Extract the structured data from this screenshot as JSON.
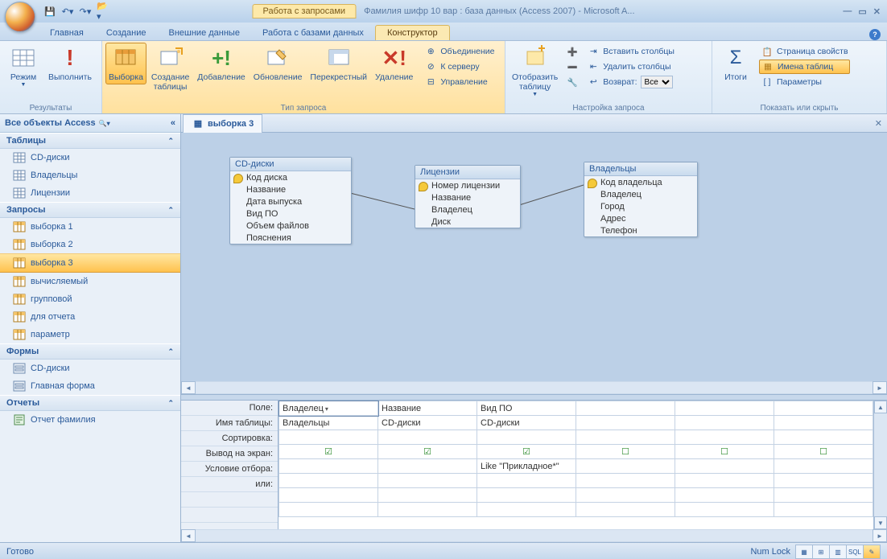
{
  "title": {
    "context_tab": "Работа с запросами",
    "document": "Фамилия шифр 10 вар : база данных (Access 2007) - Microsoft A..."
  },
  "tabs": {
    "home": "Главная",
    "create": "Создание",
    "external": "Внешние данные",
    "dbtools": "Работа с базами данных",
    "design": "Конструктор"
  },
  "ribbon": {
    "results": {
      "label": "Результаты",
      "view": "Режим",
      "run": "Выполнить"
    },
    "qtype": {
      "label": "Тип запроса",
      "select": "Выборка",
      "maketable": "Создание\nтаблицы",
      "append": "Добавление",
      "update": "Обновление",
      "crosstab": "Перекрестный",
      "delete": "Удаление",
      "union": "Объединение",
      "passthrough": "К серверу",
      "datadef": "Управление"
    },
    "setup": {
      "label": "Настройка запроса",
      "showtable": "Отобразить\nтаблицу",
      "insertcols": "Вставить столбцы",
      "deletecols": "Удалить столбцы",
      "return": "Возврат:",
      "return_val": "Все"
    },
    "showhide": {
      "label": "Показать или скрыть",
      "totals": "Итоги",
      "propsheet": "Страница свойств",
      "tablenames": "Имена таблиц",
      "params": "Параметры"
    }
  },
  "nav": {
    "title": "Все объекты Access",
    "cat_tables": "Таблицы",
    "tables": [
      "CD-диски",
      "Владельцы",
      "Лицензии"
    ],
    "cat_queries": "Запросы",
    "queries": [
      "выборка 1",
      "выборка 2",
      "выборка 3",
      "вычисляемый",
      "групповой",
      "для отчета",
      "параметр"
    ],
    "query_selected": "выборка 3",
    "cat_forms": "Формы",
    "forms": [
      "CD-диски",
      "Главная форма"
    ],
    "cat_reports": "Отчеты",
    "reports": [
      "Отчет фамилия"
    ]
  },
  "doc": {
    "tab": "выборка 3"
  },
  "tables": {
    "t1": {
      "title": "CD-диски",
      "fields": [
        "Код диска",
        "Название",
        "Дата выпуска",
        "Вид ПО",
        "Объем файлов",
        "Пояснения"
      ],
      "key": 0
    },
    "t2": {
      "title": "Лицензии",
      "fields": [
        "Номер лицензии",
        "Название",
        "Владелец",
        "Диск"
      ],
      "key": 0
    },
    "t3": {
      "title": "Владельцы",
      "fields": [
        "Код владельца",
        "Владелец",
        "Город",
        "Адрес",
        "Телефон"
      ],
      "key": 0
    }
  },
  "grid": {
    "labels": {
      "field": "Поле:",
      "table": "Имя таблицы:",
      "sort": "Сортировка:",
      "show": "Вывод на экран:",
      "criteria": "Условие отбора:",
      "or": "или:"
    },
    "cols": [
      {
        "field": "Владелец",
        "table": "Владельцы",
        "show": true,
        "criteria": ""
      },
      {
        "field": "Название",
        "table": "CD-диски",
        "show": true,
        "criteria": ""
      },
      {
        "field": "Вид ПО",
        "table": "CD-диски",
        "show": true,
        "criteria": "Like \"Прикладное*\""
      },
      {
        "field": "",
        "table": "",
        "show": false,
        "criteria": ""
      },
      {
        "field": "",
        "table": "",
        "show": false,
        "criteria": ""
      },
      {
        "field": "",
        "table": "",
        "show": false,
        "criteria": ""
      }
    ]
  },
  "status": {
    "ready": "Готово",
    "numlock": "Num Lock",
    "sql": "SQL"
  }
}
